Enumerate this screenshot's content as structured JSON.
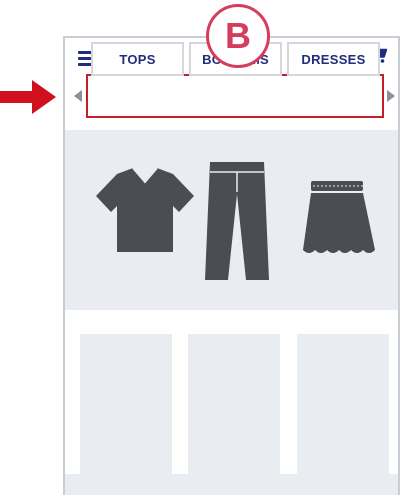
{
  "badge": {
    "letter": "B"
  },
  "header": {
    "menu_icon": "hamburger-menu-icon",
    "search_icon": "search-icon",
    "cart_icon": "shopping-cart-icon"
  },
  "tabs": [
    {
      "label": "TOPS"
    },
    {
      "label": "BOTTOMS"
    },
    {
      "label": "DRESSES"
    }
  ],
  "hero": {
    "items": [
      "t-shirt-icon",
      "pants-icon",
      "skirt-icon"
    ]
  },
  "colors": {
    "accent": "#c41e2a",
    "badge": "#d63d5c",
    "brand_navy": "#1f2d7b",
    "placeholder": "#e9ecf1",
    "clothing": "#4a4d52"
  }
}
